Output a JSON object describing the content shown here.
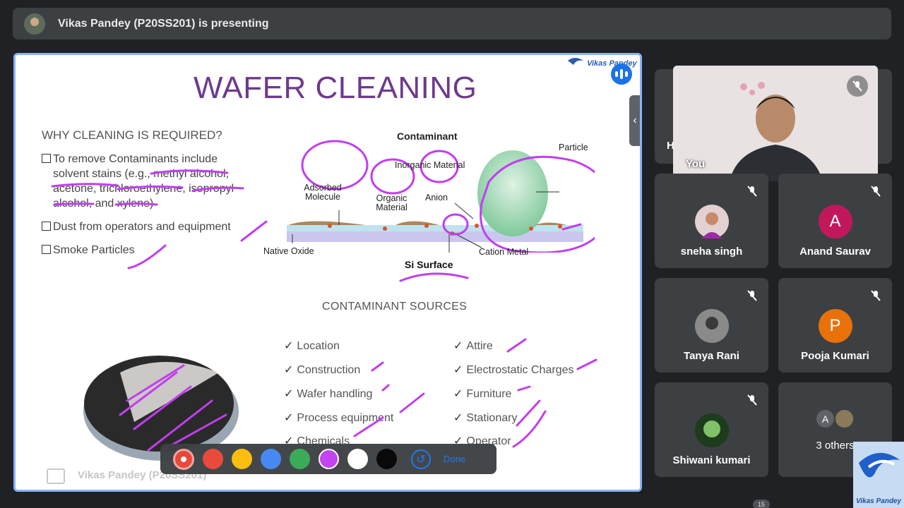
{
  "banner": {
    "presenter_text": "Vikas Pandey (P20SS201) is presenting"
  },
  "slide": {
    "title": "WAFER CLEANING",
    "why_heading": "WHY CLEANING IS REQUIRED?",
    "bullets": [
      "To remove Contaminants include solvent stains (e.g., methyl alcohol, acetone, trichloroethylene, isopropyl alcohol, and xylene)",
      "Dust from operators and equipment",
      "Smoke Particles"
    ],
    "diagram": {
      "heading": "Contaminant",
      "inorganic": "Inorganic Material",
      "particle": "Particle",
      "adsorbed": "Adsorbed Molecule",
      "organic": "Organic Material",
      "anion": "Anion",
      "native_oxide": "Native Oxide",
      "cation": "Cation Metal",
      "si_surface": "Si Surface"
    },
    "sources_heading": "CONTAMINANT SOURCES",
    "sources_left": [
      "Location",
      "Construction",
      "Wafer handling",
      "Process equipment",
      "Chemicals"
    ],
    "sources_right": [
      "Attire",
      "Electrostatic Charges",
      "Furniture",
      "Stationary",
      "Operator"
    ],
    "footer_name": "Vikas Pandey (P20SS201)",
    "logo_text": "Vikas Pandey"
  },
  "toolbar": {
    "colors": [
      "#ea4335",
      "#fbbc04",
      "#4285f4",
      "#34a853",
      "#c13ef0",
      "#ffffff",
      "#000000"
    ],
    "done_label": "Done"
  },
  "self_view": {
    "label": "You",
    "hidden_tile_letter": "H"
  },
  "participants": [
    {
      "name": "sneha singh",
      "avatar": "photo",
      "color": "#7a4b3a"
    },
    {
      "name": "Anand Saurav",
      "avatar": "A",
      "color": "#c2185b"
    },
    {
      "name": "Tanya Rani",
      "avatar": "photo",
      "color": "#6b6b6b"
    },
    {
      "name": "Pooja Kumari",
      "avatar": "P",
      "color": "#e8710a"
    },
    {
      "name": "Shiwani kumari",
      "avatar": "photo",
      "color": "#1f5a1f"
    }
  ],
  "others": {
    "label": "3 others",
    "avatar_letter": "A"
  },
  "brand_corner": "Vikas Pandey",
  "page_counter": "15"
}
